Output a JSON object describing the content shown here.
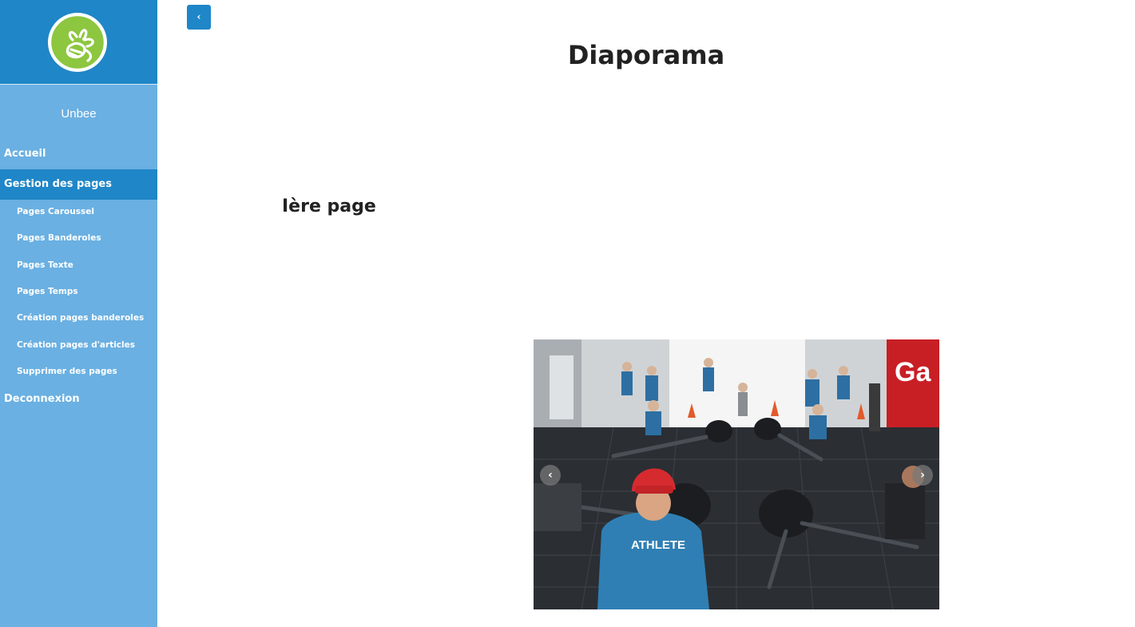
{
  "app": {
    "brand": "Unbee",
    "logo_icon": "bee-logo-icon",
    "colors": {
      "sidebar_bg": "#6ab0e2",
      "accent": "#1f86c8",
      "logo_green": "#8dc63f"
    }
  },
  "sidebar": {
    "items": [
      {
        "label": "Accueil"
      },
      {
        "label": "Gestion des pages"
      },
      {
        "label": "Deconnexion"
      }
    ],
    "subitems": [
      {
        "label": "Pages Caroussel"
      },
      {
        "label": "Pages Banderoles"
      },
      {
        "label": "Pages Texte"
      },
      {
        "label": "Pages Temps"
      },
      {
        "label": "Création pages banderoles"
      },
      {
        "label": "Création pages d'articles"
      },
      {
        "label": "Supprimer des pages"
      }
    ]
  },
  "toolbar": {
    "toggle_label": "‹"
  },
  "main": {
    "title": "Diaporama",
    "section_title": "Ière page",
    "carousel": {
      "prev_label": "‹",
      "next_label": "›",
      "shirt_text": "ATHLETE",
      "banner_text": "Ga"
    }
  }
}
